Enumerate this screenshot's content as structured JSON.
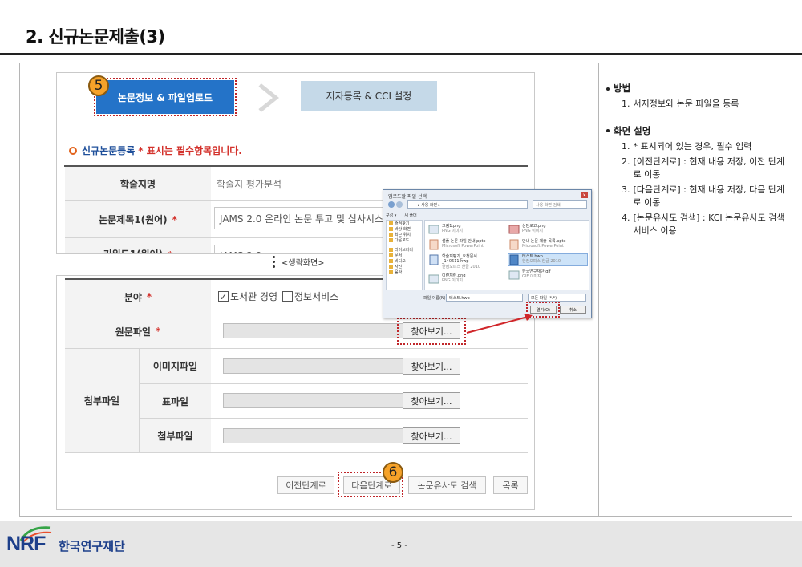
{
  "slide": {
    "title": "2. 신규논문제출(3)",
    "page_number": "- 5 -"
  },
  "steps": {
    "step1": {
      "label": "논문정보 & 파일업로드",
      "badge": "5"
    },
    "step2": {
      "label": "저자등록 & CCL설정"
    }
  },
  "form": {
    "section_title": "신규논문등록",
    "required_note": "* 표시는 필수항목입니다.",
    "journal": {
      "label": "학술지명",
      "value": "학술지 평가분석"
    },
    "title1": {
      "label": "논문제목1(원어)",
      "required": "*",
      "value": "JAMS 2.0 온라인 논문 투고 및 심사시스템"
    },
    "keyword_cut": {
      "label": "키워드1(원어)",
      "required": "*",
      "value": "JAMS 2.0"
    },
    "omitted_label": "<생략화면>",
    "field": {
      "label": "분야",
      "required": "*",
      "options": [
        "도서관 경영",
        "정보서비스"
      ],
      "checked_mark": "✓"
    },
    "original_file": {
      "label": "원문파일",
      "required": "*",
      "browse": "찾아보기..."
    },
    "attachments": {
      "group_label": "첨부파일",
      "rows": [
        {
          "label": "이미지파일",
          "browse": "찾아보기..."
        },
        {
          "label": "표파일",
          "browse": "찾아보기..."
        },
        {
          "label": "첨부파일",
          "browse": "찾아보기..."
        }
      ]
    },
    "buttons": {
      "prev": "이전단계로",
      "next": "다음단계로",
      "similarity": "논문유사도 검색",
      "list": "목록",
      "next_badge": "6"
    }
  },
  "dialog": {
    "title": "업로드할 파일 선택",
    "close": "x",
    "path": "▸ 사용 화면 ▸",
    "search_placeholder": "사용 화면 검색",
    "nav": [
      "구성 ▾",
      "새 폴더"
    ],
    "sidebar": [
      "즐겨찾기",
      "바탕 화면",
      "최근 위치",
      "다운로드",
      "라이브러리",
      "문서",
      "비디오",
      "사진",
      "음악"
    ],
    "files": [
      {
        "name": "그림1.png",
        "meta": "PNG 이미지"
      },
      {
        "name": "샘플 논문 파일 안내.pptx",
        "meta": "Microsoft PowerPoint"
      },
      {
        "name": "학술지평가_요청문서_140611.hwp",
        "meta": "한컴오피스 한글 2010"
      },
      {
        "name": "이런저런.png",
        "meta": "PNG 이미지"
      },
      {
        "name": "상단로고.png",
        "meta": "PNG 이미지"
      },
      {
        "name": "안내 논문 제출 목록.pptx",
        "meta": "Microsoft PowerPoint"
      },
      {
        "name": "테스트.hwp",
        "meta": "한컴오피스 한글 2010"
      },
      {
        "name": "한국연구재단.gif",
        "meta": "GIF 이미지"
      }
    ],
    "filename_label": "파일 이름(N):",
    "filename_value": "테스트.hwp",
    "filetype_value": "모든 파일 (*.*)",
    "open": "열기(O)",
    "cancel": "취소"
  },
  "panel": {
    "method": {
      "head": "방법",
      "items": [
        "서지정보와 논문 파일을 등록"
      ]
    },
    "screen": {
      "head": "화면 설명",
      "items": [
        "* 표시되어 있는 경우, 필수 입력",
        "[이전단계로] : 현재 내용 저장, 이전 단계로 이동",
        "[다음단계로] : 현재 내용 저장, 다음 단계로 이동",
        "[논문유사도 검색] : KCI 논문유사도 검색 서비스 이용"
      ]
    }
  },
  "footer": {
    "logo": "NRF",
    "org": "한국연구재단"
  },
  "colors": {
    "step_active": "#2473c8",
    "step_inactive": "#c5d9e8",
    "highlight": "#c0262a",
    "badge": "#f6a229",
    "arrow": "#d0262a"
  }
}
